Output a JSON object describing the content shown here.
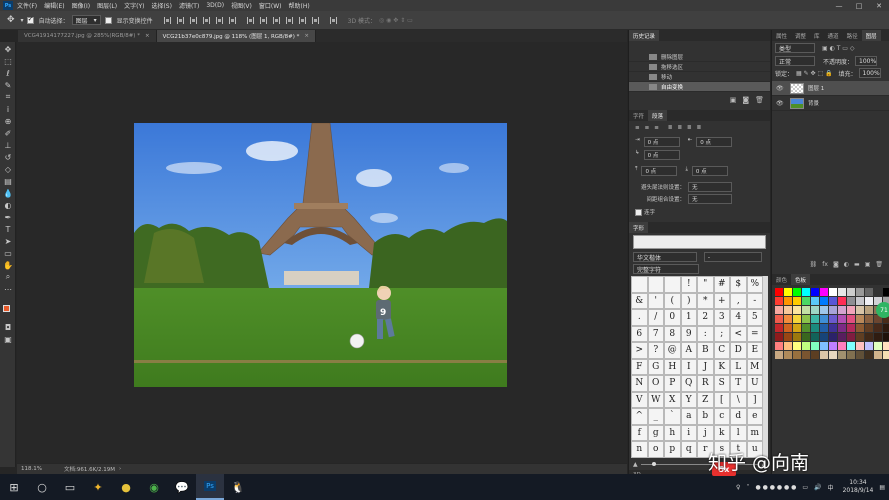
{
  "menubar": {
    "items": [
      "文件(F)",
      "编辑(E)",
      "图像(I)",
      "图层(L)",
      "文字(Y)",
      "选择(S)",
      "滤镜(T)",
      "3D(D)",
      "视图(V)",
      "窗口(W)",
      "帮助(H)"
    ],
    "win_controls": [
      "—",
      "□",
      "✕"
    ]
  },
  "options": {
    "auto_select_label": "自动选择：",
    "auto_select_value": "图层",
    "show_transform_label": "显示变换控件",
    "mode3d_label": "3D 模式："
  },
  "tabs": [
    {
      "label": "VCG41914177227.jpg @ 285%(RGB/8#) *",
      "close": "×"
    },
    {
      "label": "VCG21b37e0c879.jpg @ 118% (图层 1, RGB/8#) *",
      "close": "×"
    }
  ],
  "status": {
    "zoom": "118.1%",
    "doc": "文档:961.6K/2.19M",
    "arrow": "›"
  },
  "history": {
    "tabs": [
      "历史记录"
    ],
    "items": [
      "删除图层",
      "拖移选区",
      "移动",
      "自由变换"
    ],
    "selected_index": 3
  },
  "paragraph": {
    "tabs": [
      "字符",
      "段落"
    ],
    "indent_left": "0 点",
    "indent_right": "0 点",
    "first_indent": "0 点",
    "space_before": "0 点",
    "space_after": "0 点",
    "kinsoku_label": "避头尾法则设置：",
    "kinsoku_value": "无",
    "mojikumi_label": "间距组合设置：",
    "mojikumi_value": "无",
    "hyphen_label": "连字"
  },
  "glyphs": {
    "title": "字形",
    "font": "华文楷体",
    "style": "-",
    "set": "完整字符",
    "chars": [
      "",
      "",
      "",
      "!",
      "\"",
      "#",
      "$",
      "%",
      "&",
      "'",
      "(",
      ")",
      "*",
      "+",
      ",",
      "-",
      ".",
      "/",
      "0",
      "1",
      "2",
      "3",
      "4",
      "5",
      "6",
      "7",
      "8",
      "9",
      ":",
      ";",
      "<",
      "=",
      ">",
      "?",
      "@",
      "A",
      "B",
      "C",
      "D",
      "E",
      "F",
      "G",
      "H",
      "I",
      "J",
      "K",
      "L",
      "M",
      "N",
      "O",
      "P",
      "Q",
      "R",
      "S",
      "T",
      "U",
      "V",
      "W",
      "X",
      "Y",
      "Z",
      "[",
      "\\",
      "]",
      "^",
      "_",
      "`",
      "a",
      "b",
      "c",
      "d",
      "e",
      "f",
      "g",
      "h",
      "i",
      "j",
      "k",
      "l",
      "m",
      "n",
      "o",
      "p",
      "q",
      "r",
      "s",
      "t",
      "u"
    ],
    "bottom": "3D"
  },
  "right": {
    "top_tabs": [
      "属性",
      "调整",
      "库",
      "通道",
      "路径",
      "图层"
    ],
    "kind": "类型",
    "blend": "正常",
    "opacity_label": "不透明度：",
    "opacity": "100%",
    "lock_label": "锁定：",
    "fill_label": "填充：",
    "fill": "100%",
    "layers": [
      "图层 1",
      "背景"
    ],
    "swatch_tabs": [
      "颜色",
      "色板"
    ],
    "badge": "71"
  },
  "taskbar": {
    "time": "10:34",
    "date": "2018/9/14"
  },
  "watermark": {
    "text": "知乎 @向南",
    "logo": "5x"
  }
}
